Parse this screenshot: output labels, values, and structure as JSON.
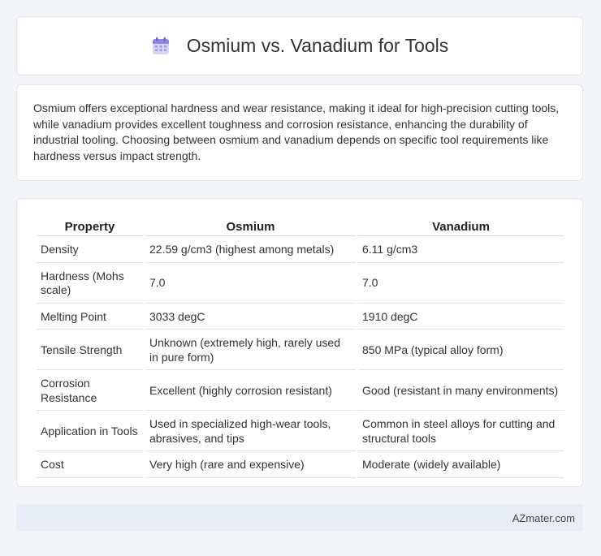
{
  "header": {
    "title": "Osmium vs. Vanadium for Tools",
    "icon": "calendar-icon"
  },
  "summary": {
    "text": "Osmium offers exceptional hardness and wear resistance, making it ideal for high-precision cutting tools, while vanadium provides excellent toughness and corrosion resistance, enhancing the durability of industrial tooling. Choosing between osmium and vanadium depends on specific tool requirements like hardness versus impact strength."
  },
  "table": {
    "headers": [
      "Property",
      "Osmium",
      "Vanadium"
    ],
    "rows": [
      [
        "Density",
        "22.59 g/cm3 (highest among metals)",
        "6.11 g/cm3"
      ],
      [
        "Hardness (Mohs scale)",
        "7.0",
        "7.0"
      ],
      [
        "Melting Point",
        "3033 degC",
        "1910 degC"
      ],
      [
        "Tensile Strength",
        "Unknown (extremely high, rarely used in pure form)",
        "850 MPa (typical alloy form)"
      ],
      [
        "Corrosion Resistance",
        "Excellent (highly corrosion resistant)",
        "Good (resistant in many environments)"
      ],
      [
        "Application in Tools",
        "Used in specialized high-wear tools, abrasives, and tips",
        "Common in steel alloys for cutting and structural tools"
      ],
      [
        "Cost",
        "Very high (rare and expensive)",
        "Moderate (widely available)"
      ]
    ]
  },
  "footer": {
    "brand": "AZmater.com"
  }
}
